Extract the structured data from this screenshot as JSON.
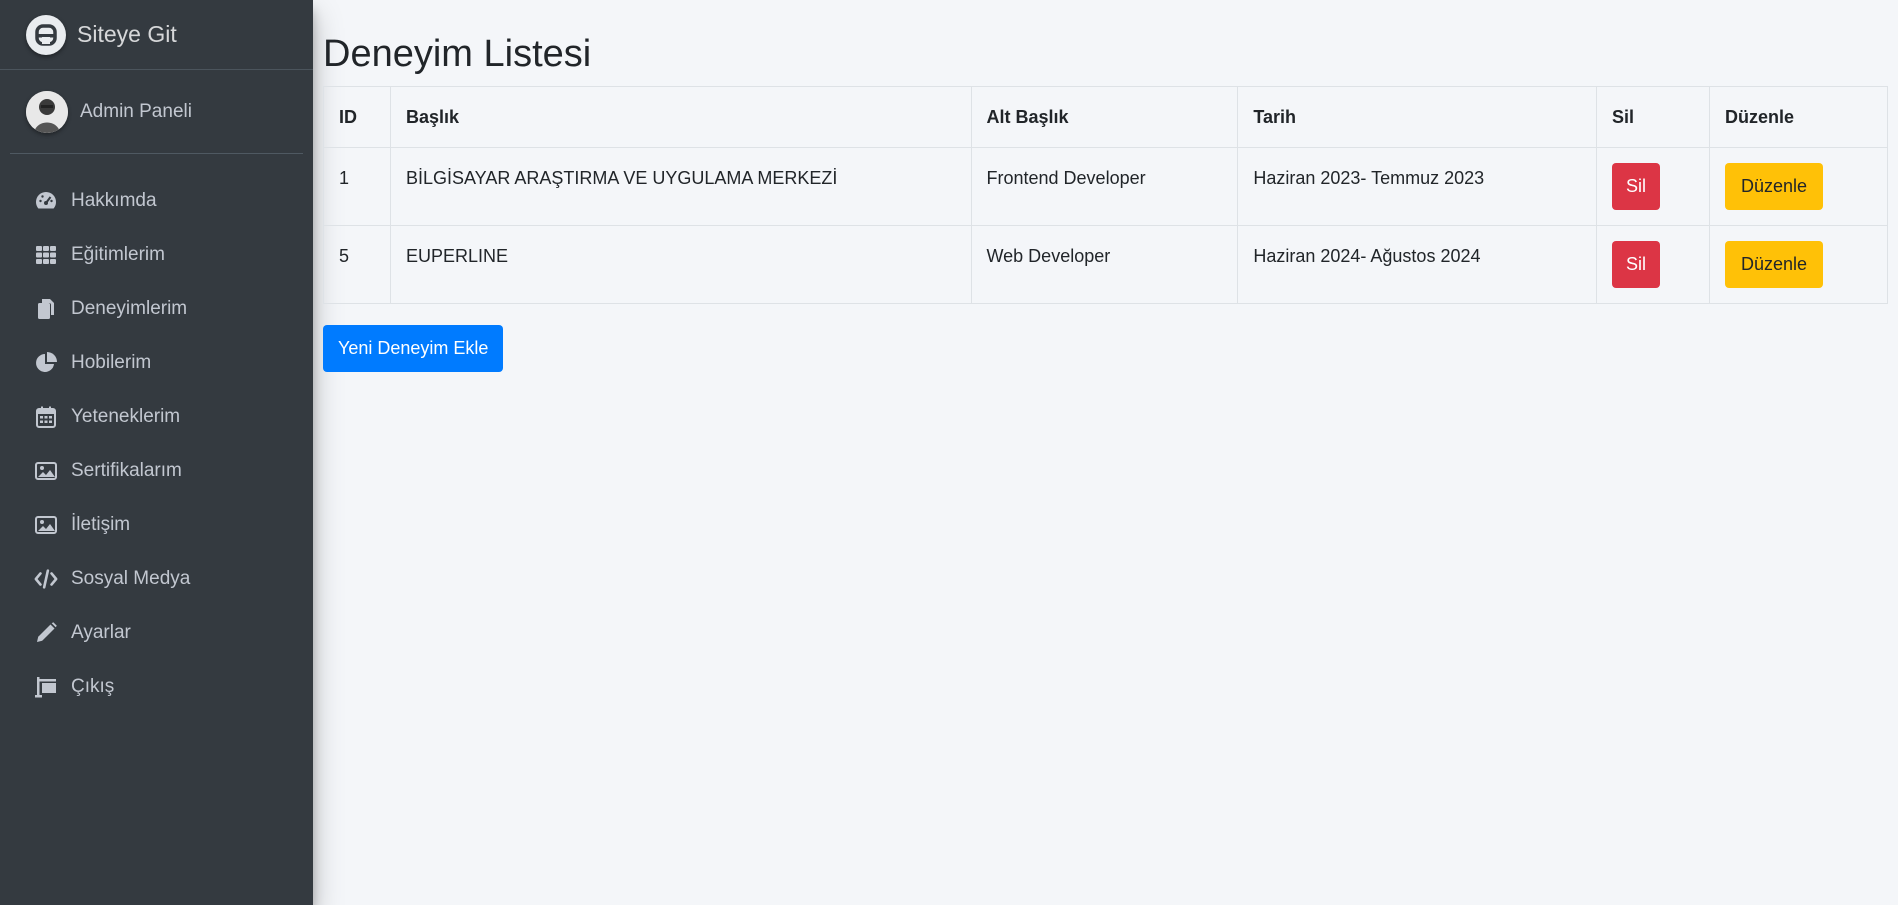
{
  "sidebar": {
    "brand": "Siteye Git",
    "user": "Admin Paneli",
    "items": [
      {
        "label": "Hakkımda",
        "icon": "tachometer-icon"
      },
      {
        "label": "Eğitimlerim",
        "icon": "grid-icon"
      },
      {
        "label": "Deneyimlerim",
        "icon": "copy-icon"
      },
      {
        "label": "Hobilerim",
        "icon": "pie-chart-icon"
      },
      {
        "label": "Yeteneklerim",
        "icon": "calendar-icon"
      },
      {
        "label": "Sertifikalarım",
        "icon": "image-icon"
      },
      {
        "label": "İletişim",
        "icon": "image-icon"
      },
      {
        "label": "Sosyal Medya",
        "icon": "code-icon"
      },
      {
        "label": "Ayarlar",
        "icon": "pencil-icon"
      },
      {
        "label": "Çıkış",
        "icon": "sign-icon"
      }
    ]
  },
  "main": {
    "title": "Deneyim Listesi",
    "table": {
      "headers": [
        "ID",
        "Başlık",
        "Alt Başlık",
        "Tarih",
        "Sil",
        "Düzenle"
      ],
      "rows": [
        {
          "id": "1",
          "title": "BİLGİSAYAR ARAŞTIRMA VE UYGULAMA MERKEZİ",
          "subtitle": "Frontend Developer",
          "date": "Haziran 2023- Temmuz 2023"
        },
        {
          "id": "5",
          "title": "EUPERLINE",
          "subtitle": "Web Developer",
          "date": "Haziran 2024- Ağustos 2024"
        }
      ],
      "delete_label": "Sil",
      "edit_label": "Düzenle"
    },
    "add_button": "Yeni Deneyim Ekle"
  },
  "colors": {
    "sidebar_bg": "#343a40",
    "danger": "#dc3545",
    "warning": "#ffc107",
    "primary": "#007bff"
  }
}
